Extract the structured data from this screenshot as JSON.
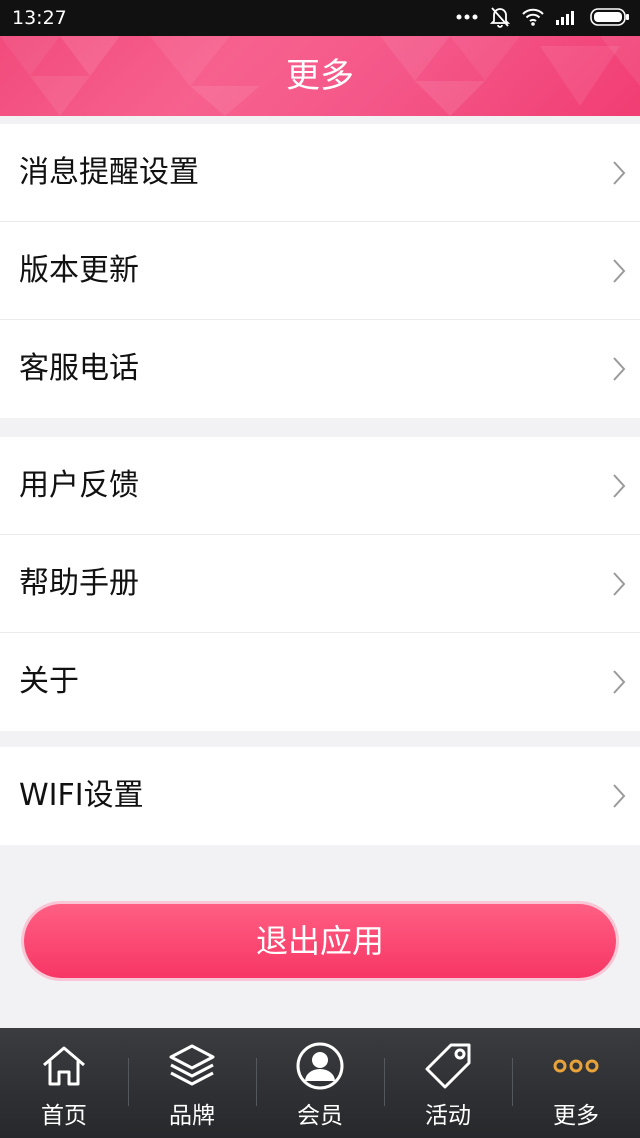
{
  "status_bar": {
    "time": "13:27"
  },
  "header": {
    "title": "更多"
  },
  "groups": [
    {
      "items": [
        {
          "label": "消息提醒设置"
        },
        {
          "label": "版本更新"
        },
        {
          "label": "客服电话"
        }
      ]
    },
    {
      "items": [
        {
          "label": "用户反馈"
        },
        {
          "label": "帮助手册"
        },
        {
          "label": "关于"
        }
      ]
    },
    {
      "items": [
        {
          "label": "WIFI设置"
        }
      ]
    }
  ],
  "logout_button": {
    "label": "退出应用"
  },
  "tabbar": {
    "tabs": [
      {
        "label": "首页",
        "icon": "home-icon"
      },
      {
        "label": "品牌",
        "icon": "layers-icon"
      },
      {
        "label": "会员",
        "icon": "user-icon"
      },
      {
        "label": "活动",
        "icon": "tag-icon"
      },
      {
        "label": "更多",
        "icon": "more-dots-icon",
        "active": true
      }
    ]
  },
  "colors": {
    "accent": "#f4507f",
    "active_tab_icon": "#e8a33a",
    "tabbar": "#2f3135"
  }
}
